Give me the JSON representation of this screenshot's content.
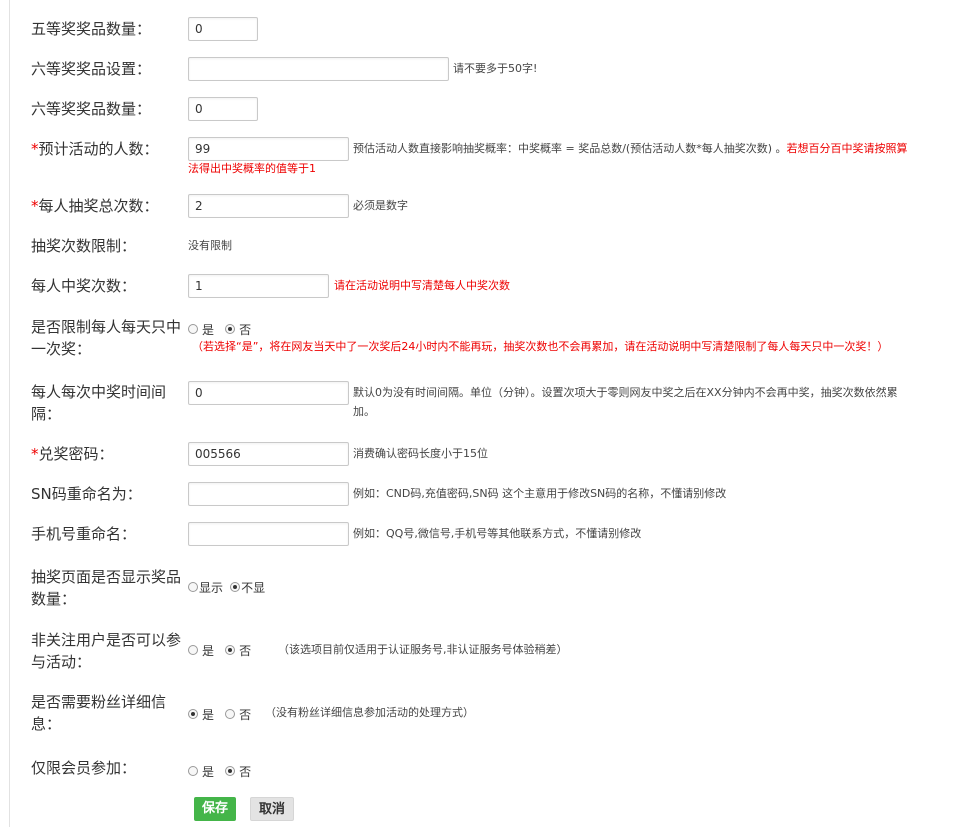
{
  "form": {
    "fifth_prize_qty": {
      "label": "五等奖奖品数量：",
      "value": "0"
    },
    "sixth_prize_setting": {
      "label": "六等奖奖品设置：",
      "value": "",
      "hint": "请不要多于50字!"
    },
    "sixth_prize_qty": {
      "label": "六等奖奖品数量：",
      "value": "0"
    },
    "expected_participants": {
      "star": "*",
      "label": "预计活动的人数：",
      "value": "99",
      "hint": "预估活动人数直接影响抽奖概率：中奖概率 = 奖品总数/(预估活动人数*每人抽奖次数) 。",
      "hint_red_1": "若想百分百中奖请按照算",
      "hint_red_2": "法得出中奖概率的值等于1"
    },
    "draws_per_person": {
      "star": "*",
      "label": "每人抽奖总次数：",
      "value": "2",
      "hint": "必须是数字"
    },
    "draw_limit": {
      "label": "抽奖次数限制：",
      "value": "没有限制"
    },
    "wins_per_person": {
      "label": "每人中奖次数：",
      "value": "1",
      "hint": "请在活动说明中写清楚每人中奖次数"
    },
    "daily_limit": {
      "label_1": "是否限制每人每天只中",
      "label_2": "一次奖：",
      "yes": "是",
      "no": "否",
      "hint": "（若选择“是”，将在网友当天中了一次奖后24小时内不能再玩，抽奖次数也不会再累加，请在活动说明中写清楚限制了每人每天只中一次奖！）"
    },
    "win_interval": {
      "label_1": "每人每次中奖时间间",
      "label_2": "隔：",
      "value": "0",
      "hint_1": "默认0为没有时间间隔。单位（分钟）。设置次项大于零则网友中奖之后在XX分钟内不会再中奖，抽奖次数依然累",
      "hint_2": "加。"
    },
    "redeem_password": {
      "star": "*",
      "label": "兑奖密码：",
      "value": "005566",
      "hint": "消费确认密码长度小于15位"
    },
    "sn_rename": {
      "label": "SN码重命名为：",
      "value": "",
      "hint": "例如：CND码,充值密码,SN码 这个主意用于修改SN码的名称，不懂请别修改"
    },
    "phone_rename": {
      "label": "手机号重命名：",
      "value": "",
      "hint": "例如：QQ号,微信号,手机号等其他联系方式，不懂请别修改"
    },
    "show_prize_qty": {
      "label_1": "抽奖页面是否显示奖品",
      "label_2": "数量：",
      "yes": "显示",
      "no": "不显"
    },
    "non_follower": {
      "label_1": "非关注用户是否可以参",
      "label_2": "与活动：",
      "yes": "是",
      "no": "否",
      "hint": "（该选项目前仅适用于认证服务号,非认证服务号体验稍差）"
    },
    "fan_details": {
      "label_1": "是否需要粉丝详细信",
      "label_2": "息：",
      "yes": "是",
      "no": "否",
      "hint": "（没有粉丝详细信息参加活动的处理方式）"
    },
    "members_only": {
      "label": "仅限会员参加：",
      "yes": "是",
      "no": "否"
    }
  },
  "buttons": {
    "save": "保存",
    "cancel": "取消"
  }
}
